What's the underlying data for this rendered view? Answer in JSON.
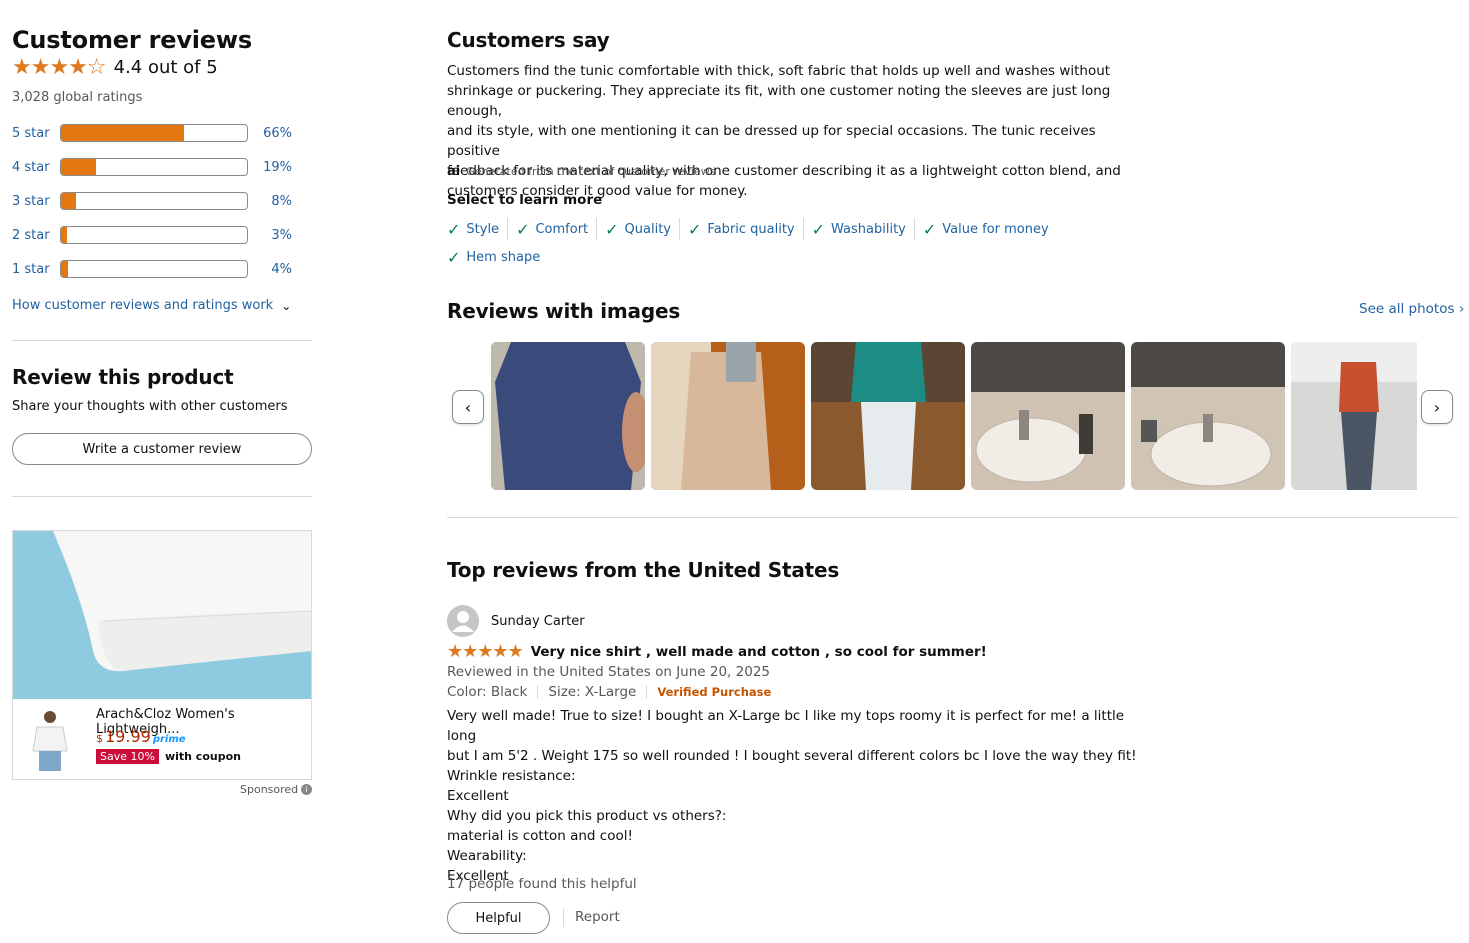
{
  "summary": {
    "title": "Customer reviews",
    "rating_stars": "★★★★☆",
    "rating_text": "4.4 out of 5",
    "global_ratings": "3,028 global ratings",
    "histogram": [
      {
        "label": "5 star",
        "pct": "66%",
        "fraction": 0.66
      },
      {
        "label": "4 star",
        "pct": "19%",
        "fraction": 0.19
      },
      {
        "label": "3 star",
        "pct": "8%",
        "fraction": 0.08
      },
      {
        "label": "2 star",
        "pct": "3%",
        "fraction": 0.03
      },
      {
        "label": "1 star",
        "pct": "4%",
        "fraction": 0.04
      }
    ],
    "how_link": "How customer reviews and ratings work"
  },
  "review_product": {
    "title": "Review this product",
    "subtitle": "Share your thoughts with other customers",
    "button": "Write a customer review"
  },
  "ad": {
    "product_name": "Arach&Cloz Women's Lightweigh...",
    "price_symbol": "$",
    "price": "19.99",
    "prime": "prime",
    "save_badge": "Save 10%",
    "coupon_text": "with coupon",
    "sponsored": "Sponsored"
  },
  "customers_say": {
    "title": "Customers say",
    "lines": [
      "Customers find the tunic comfortable with thick, soft fabric that holds up well and washes without",
      "shrinkage or puckering. They appreciate its fit, with one customer noting the sleeves are just long enough,",
      "and its style, with one mentioning it can be dressed up for special occasions. The tunic receives positive",
      "feedback for its material quality, with one customer describing it as a lightweight cotton blend, and",
      "customers consider it good value for money."
    ],
    "ai_label": "ai",
    "generated_note": "Generated from the text of customer reviews",
    "select_label": "Select to learn more",
    "aspects_row1": [
      "Style",
      "Comfort",
      "Quality",
      "Fabric quality",
      "Washability",
      "Value for money"
    ],
    "aspects_row2": [
      "Hem shape"
    ]
  },
  "reviews_with_images": {
    "title": "Reviews with images",
    "see_all": "See all photos",
    "prev_icon": "‹",
    "next_icon": "›"
  },
  "top_reviews": {
    "title": "Top reviews from the United States",
    "review": {
      "author": "Sunday Carter",
      "stars": "★★★★★",
      "headline": "Very nice shirt , well made and cotton , so cool for summer!",
      "meta": "Reviewed in the United States on June 20, 2025",
      "color": "Color: Black",
      "size": "Size: X-Large",
      "verified": "Verified Purchase",
      "body": [
        "Very well made! True to size! I bought an X-Large bc I like my tops roomy it is perfect for me! a little long",
        "but I am 5'2 . Weight 175 so well rounded ! I bought several different colors bc I love the way they fit!",
        "Wrinkle resistance:",
        "Excellent",
        "Why did you pick this product vs others?:",
        "material is cotton and cool!",
        "Wearability:",
        "Excellent"
      ],
      "helpful_count": "17 people found this helpful",
      "helpful_button": "Helpful",
      "report": "Report"
    }
  },
  "colors": {
    "star": "#de7921",
    "bar": "#e47911",
    "link": "#2162a1",
    "verified": "#c45500",
    "save_badge": "#cc0c39"
  }
}
